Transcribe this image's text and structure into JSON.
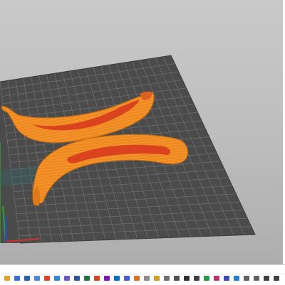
{
  "app": {
    "view": "3d-slicer-preview",
    "model": "two-bananas"
  },
  "colors": {
    "background_top": "#c9c9c9",
    "background_bottom": "#aeaeae",
    "bed": "#4b4b4b",
    "grid_line": "#6d6d6d",
    "model_outer": "#ee8a20",
    "model_edge": "#c86a10",
    "model_inner": "#d83a1e",
    "axis_x": "#d2302a",
    "axis_y": "#2aa02a",
    "axis_z": "#2a4ad2"
  },
  "taskbar": {
    "icons": [
      {
        "name": "file-explorer-icon",
        "color": "#e0a030"
      },
      {
        "name": "browser-icon",
        "color": "#3a6fd8"
      },
      {
        "name": "mail-icon",
        "color": "#2b5fa8"
      },
      {
        "name": "store-icon",
        "color": "#4a88d8"
      },
      {
        "name": "chrome-icon",
        "color": "#d8452b"
      },
      {
        "name": "edge-icon",
        "color": "#2a8ad0"
      },
      {
        "name": "photos-icon",
        "color": "#6a5ac8"
      },
      {
        "name": "word-icon",
        "color": "#2b579a"
      },
      {
        "name": "excel-icon",
        "color": "#217346"
      },
      {
        "name": "powerpoint-icon",
        "color": "#d24726"
      },
      {
        "name": "onenote-icon",
        "color": "#7719aa"
      },
      {
        "name": "outlook-icon",
        "color": "#0072c6"
      },
      {
        "name": "teams-icon",
        "color": "#5059c9"
      },
      {
        "name": "slicer-icon",
        "color": "#e07020"
      },
      {
        "name": "notepad-icon",
        "color": "#8a8a8a"
      },
      {
        "name": "paint-icon",
        "color": "#d0a020"
      },
      {
        "name": "settings-icon",
        "color": "#707070"
      },
      {
        "name": "calculator-icon",
        "color": "#505050"
      },
      {
        "name": "terminal-icon",
        "color": "#303030"
      },
      {
        "name": "camera-icon",
        "color": "#404040"
      },
      {
        "name": "maps-icon",
        "color": "#2a9a4a"
      },
      {
        "name": "music-icon",
        "color": "#c0306a"
      },
      {
        "name": "video-icon",
        "color": "#3a4ab0"
      },
      {
        "name": "security-icon",
        "color": "#2a7ad0"
      },
      {
        "name": "network-icon",
        "color": "#606060"
      },
      {
        "name": "volume-icon",
        "color": "#606060"
      },
      {
        "name": "clock-icon",
        "color": "#404040"
      },
      {
        "name": "notification-icon",
        "color": "#404040"
      }
    ]
  }
}
